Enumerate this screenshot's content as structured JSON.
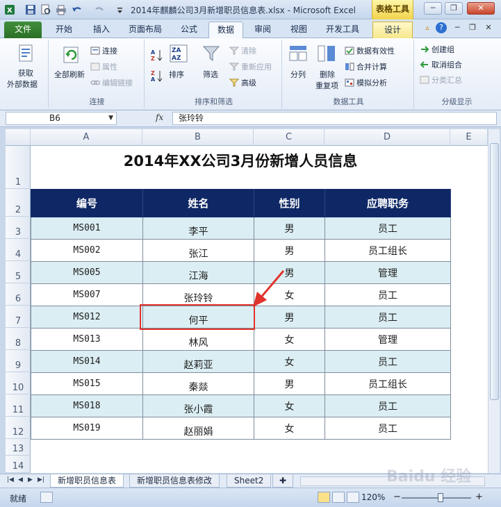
{
  "window": {
    "title": "2014年麒麟公司3月新增职员信息表.xlsx  -  Microsoft Excel",
    "contextual_tab_group": "表格工具",
    "controls": {
      "minimize": "─",
      "restore": "❐",
      "close": "✕"
    }
  },
  "ribbon_tabs": [
    {
      "label": "文件"
    },
    {
      "label": "开始"
    },
    {
      "label": "插入"
    },
    {
      "label": "页面布局"
    },
    {
      "label": "公式"
    },
    {
      "label": "数据"
    },
    {
      "label": "审阅"
    },
    {
      "label": "视图"
    },
    {
      "label": "开发工具"
    },
    {
      "label": "设计"
    }
  ],
  "ribbon": {
    "get_external": {
      "line1": "获取",
      "line2": "外部数据"
    },
    "connections": {
      "refresh_all": "全部刷新",
      "connect": "连接",
      "properties": "属性",
      "edit_links": "编辑链接",
      "label": "连接"
    },
    "sort_filter": {
      "sort": "排序",
      "filter": "筛选",
      "clear": "清除",
      "reapply": "重新应用",
      "advanced": "高级",
      "label": "排序和筛选"
    },
    "data_tools": {
      "text_to_columns": "分列",
      "remove_duplicates_1": "删除",
      "remove_duplicates_2": "重复项",
      "validation": "数据有效性",
      "consolidate": "合并计算",
      "what_if": "模拟分析",
      "label": "数据工具"
    },
    "outline": {
      "group": "创建组",
      "ungroup": "取消组合",
      "subtotal": "分类汇总",
      "label": "分级显示"
    }
  },
  "formula_bar": {
    "name_box": "B6",
    "fx": "fx",
    "value": "张玲铃"
  },
  "columns": [
    "A",
    "B",
    "C",
    "D",
    "E"
  ],
  "rows": [
    "1",
    "2",
    "3",
    "4",
    "5",
    "6",
    "7",
    "8",
    "9",
    "10",
    "11",
    "12",
    "13",
    "14"
  ],
  "sheet_title": "2014年XX公司3月份新增人员信息",
  "table": {
    "headers": [
      "编号",
      "姓名",
      "性别",
      "应聘职务"
    ],
    "rows": [
      [
        "MS001",
        "李平",
        "男",
        "员工"
      ],
      [
        "MS002",
        "张江",
        "男",
        "员工组长"
      ],
      [
        "MS005",
        "江海",
        "男",
        "管理"
      ],
      [
        "MS007",
        "张玲铃",
        "女",
        "员工"
      ],
      [
        "MS012",
        "何平",
        "男",
        "员工"
      ],
      [
        "MS013",
        "林风",
        "女",
        "管理"
      ],
      [
        "MS014",
        "赵莉亚",
        "女",
        "员工"
      ],
      [
        "MS015",
        "秦燚",
        "男",
        "员工组长"
      ],
      [
        "MS018",
        "张小霞",
        "女",
        "员工"
      ],
      [
        "MS019",
        "赵丽娟",
        "女",
        "员工"
      ]
    ]
  },
  "sheet_tabs": [
    "新增职员信息表",
    "新增职员信息表修改",
    "Sheet2"
  ],
  "status": {
    "text": "就绪",
    "zoom": "120%",
    "zoom_out": "−",
    "zoom_in": "+"
  },
  "watermark": "Baidu 经验",
  "colors": {
    "header_bg": "#0f2865",
    "band_bg": "#dbeef3",
    "annotation": "#e0332c",
    "file_tab": "#2b6f27"
  }
}
